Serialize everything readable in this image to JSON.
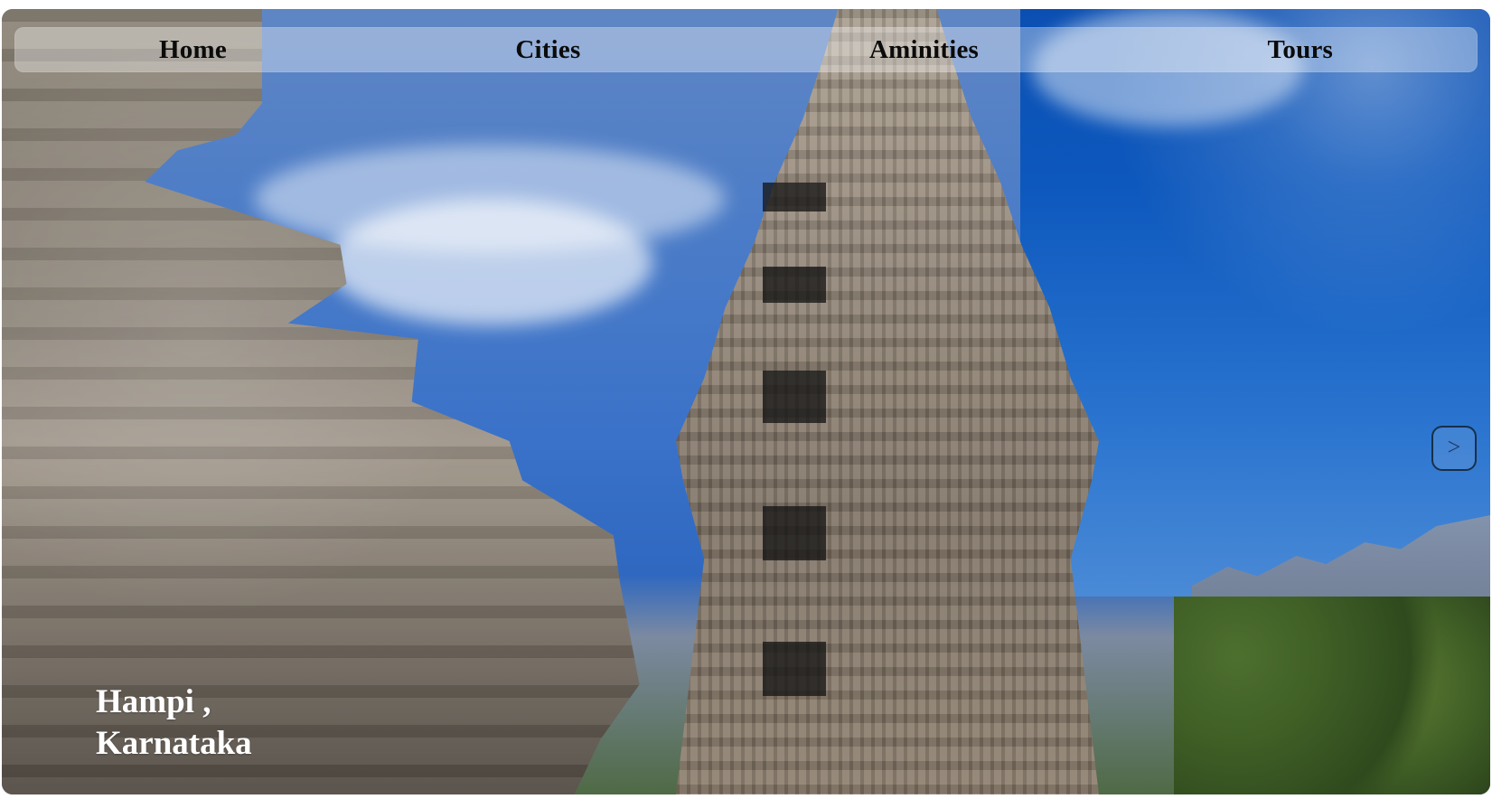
{
  "nav": {
    "items": [
      {
        "label": "Home"
      },
      {
        "label": "Cities"
      },
      {
        "label": "Aminities"
      },
      {
        "label": "Tours"
      }
    ]
  },
  "hero": {
    "caption_line_1": "Hampi ,",
    "caption_line_2": "Karnataka"
  },
  "carousel": {
    "next_label": ">"
  }
}
